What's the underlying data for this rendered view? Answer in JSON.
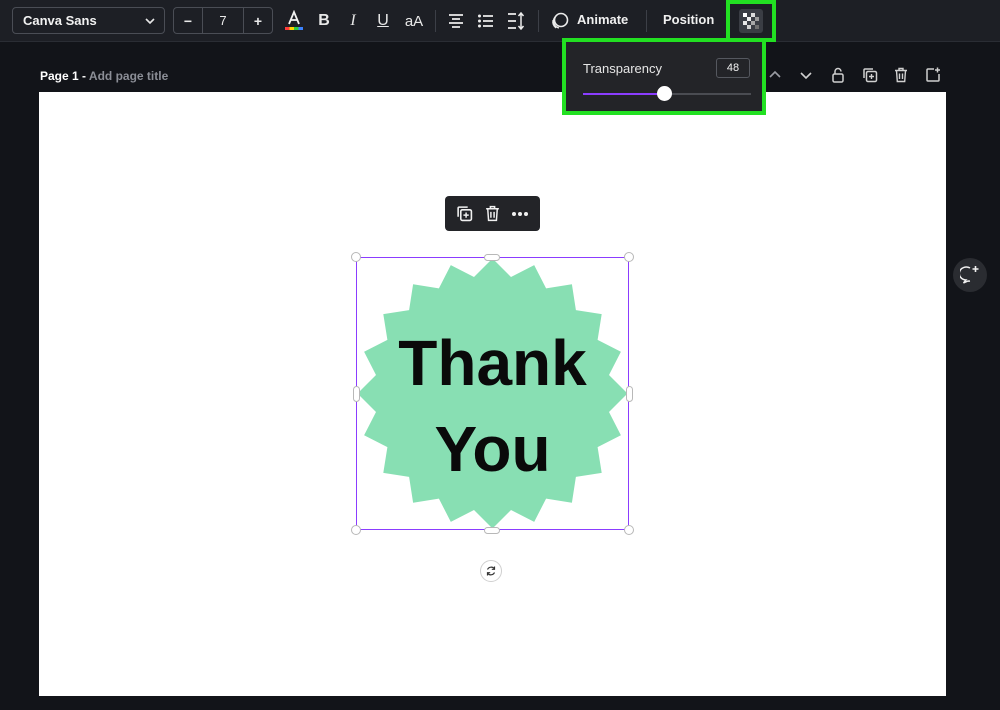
{
  "toolbar": {
    "font_name": "Canva Sans",
    "font_size": "7",
    "size_minus": "−",
    "size_plus": "+",
    "bold_label": "B",
    "italic_label": "I",
    "underline_label": "U",
    "case_label": "aA",
    "animate_label": "Animate",
    "position_label": "Position",
    "icons": [
      "chevron-down-icon",
      "text-color-icon",
      "align-center-icon",
      "list-icon",
      "line-spacing-icon",
      "animate-icon",
      "transparency-icon"
    ]
  },
  "page": {
    "label": "Page 1 - ",
    "title_placeholder": "Add page title",
    "actions": [
      "chevron-up-icon",
      "chevron-down-icon",
      "lock-icon",
      "duplicate-page-icon",
      "delete-page-icon",
      "add-page-icon"
    ]
  },
  "element_menu": {
    "icons": [
      "duplicate-icon",
      "delete-icon",
      "more-icon"
    ]
  },
  "canvas": {
    "text_line1": "Thank",
    "text_line2": "You",
    "badge_color": "#88dfb3",
    "selection_color": "#8b3dff"
  },
  "transparency_popup": {
    "label": "Transparency",
    "value": "48",
    "slider_percent": 48
  },
  "colors": {
    "highlight": "#22e022",
    "accent": "#8b3dff"
  }
}
